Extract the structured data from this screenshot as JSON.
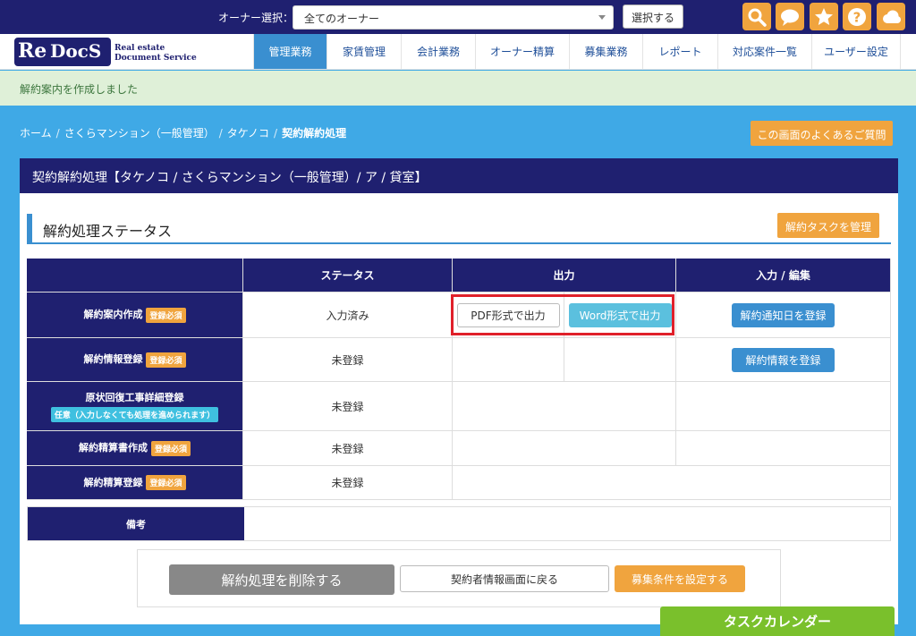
{
  "topbar": {
    "owner_label": "オーナー選択：",
    "owner_value": "全てのオーナー",
    "select_button": "選択する",
    "icons": [
      "search-icon",
      "chat-icon",
      "star-icon",
      "help-icon",
      "cloud-icon"
    ],
    "accent": "#f0a43e",
    "bar_color": "#1f2070"
  },
  "logo": {
    "re": "Re",
    "docs": "DocS",
    "tagline1": "Real estate",
    "tagline2": "Document Service"
  },
  "nav": {
    "items": [
      {
        "label": "管理業務",
        "active": true
      },
      {
        "label": "家賃管理"
      },
      {
        "label": "会計業務"
      },
      {
        "label": "オーナー精算"
      },
      {
        "label": "募集業務"
      },
      {
        "label": "レポート"
      },
      {
        "label": "対応案件一覧"
      },
      {
        "label": "ユーザー設定"
      }
    ]
  },
  "flash": "解約案内を作成しました",
  "breadcrumb": {
    "items": [
      "ホーム",
      "さくらマンション（一般管理）",
      "タケノコ",
      "契約解約処理"
    ]
  },
  "faq_button": "この画面のよくあるご質問",
  "panel": {
    "title": "契約解約処理【タケノコ / さくらマンション（一般管理）/ ア / 貸室】",
    "section_title": "解約処理ステータス",
    "task_button": "解約タスクを管理"
  },
  "table": {
    "headers": [
      "",
      "ステータス",
      "出力",
      "入力 / 編集"
    ],
    "rows": [
      {
        "label": "解約案内作成",
        "badge": "登録必須",
        "status": "入力済み",
        "pdf": "PDF形式で出力",
        "word": "Word形式で出力",
        "action": "解約通知日を登録"
      },
      {
        "label": "解約情報登録",
        "badge": "登録必須",
        "status": "未登録",
        "action": "解約情報を登録"
      },
      {
        "label": "原状回復工事詳細登録",
        "note": "任意（入力しなくても処理を進められます）",
        "status": "未登録"
      },
      {
        "label": "解約精算書作成",
        "badge": "登録必須",
        "status": "未登録"
      },
      {
        "label": "解約精算登録",
        "badge": "登録必須",
        "status": "未登録"
      }
    ],
    "notes_label": "備考"
  },
  "actions": {
    "delete": "解約処理を削除する",
    "back": "契約者情報画面に戻る",
    "recruit": "募集条件を設定する"
  },
  "calendar": "タスクカレンダー"
}
